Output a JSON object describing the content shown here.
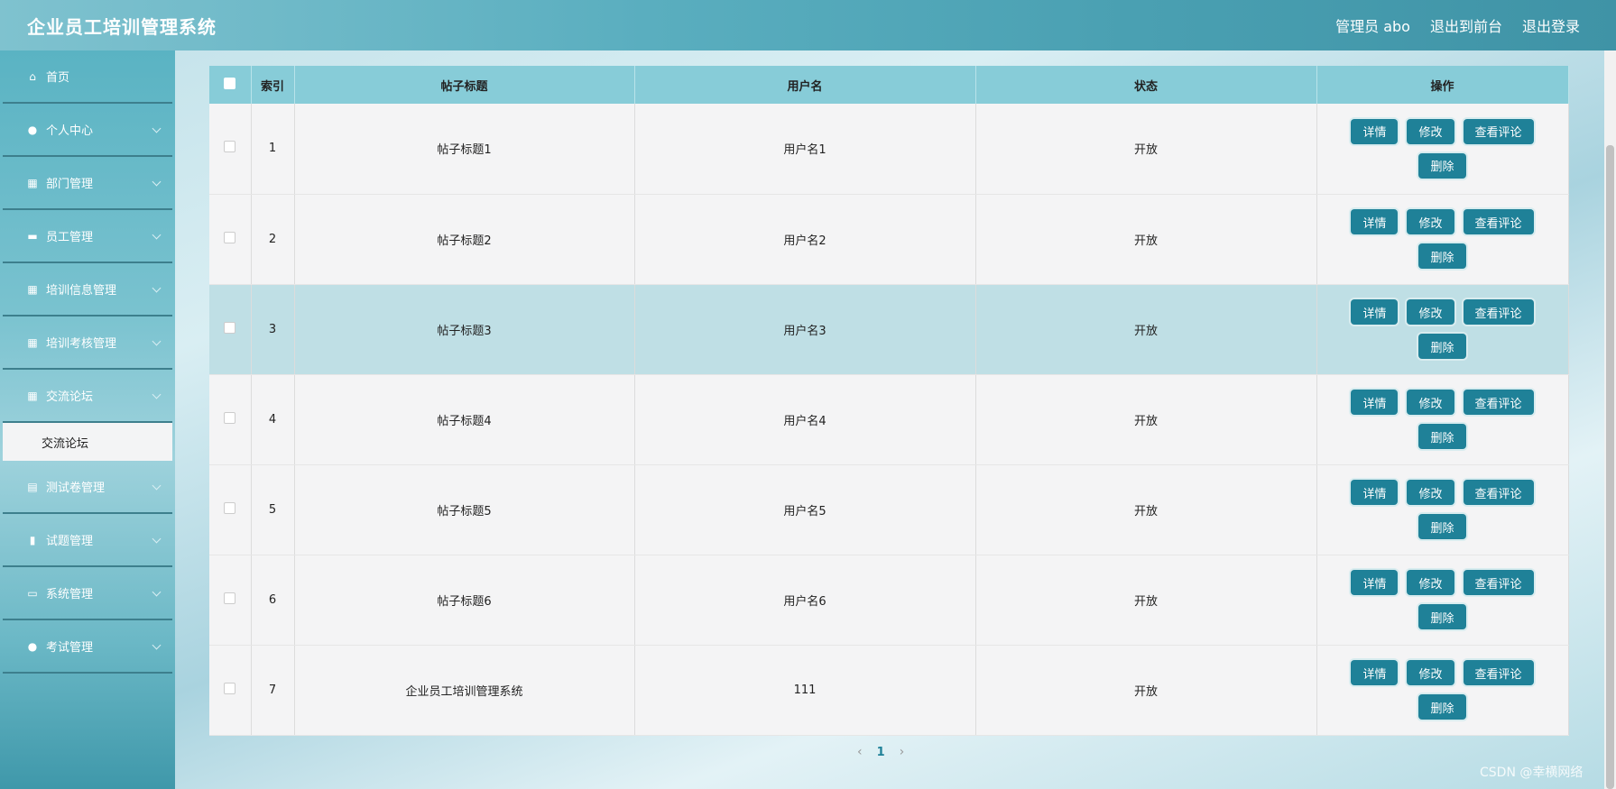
{
  "header": {
    "title": "企业员工培训管理系统",
    "user": "管理员 abo",
    "to_front": "退出到前台",
    "logout": "退出登录"
  },
  "sidebar": {
    "items": [
      {
        "label": "首页",
        "icon": "home-icon"
      },
      {
        "label": "个人中心",
        "icon": "user-icon"
      },
      {
        "label": "部门管理",
        "icon": "grid-icon"
      },
      {
        "label": "员工管理",
        "icon": "briefcase-icon"
      },
      {
        "label": "培训信息管理",
        "icon": "grid-icon"
      },
      {
        "label": "培训考核管理",
        "icon": "grid-icon"
      },
      {
        "label": "交流论坛",
        "icon": "grid-icon"
      },
      {
        "label": "交流论坛",
        "icon": ""
      },
      {
        "label": "测试卷管理",
        "icon": "clipboard-icon"
      },
      {
        "label": "试题管理",
        "icon": "bar-chart-icon"
      },
      {
        "label": "系统管理",
        "icon": "monitor-icon"
      },
      {
        "label": "考试管理",
        "icon": "pin-icon"
      }
    ]
  },
  "table": {
    "headers": [
      "索引",
      "帖子标题",
      "用户名",
      "状态",
      "操作"
    ],
    "rows": [
      {
        "index": "1",
        "title": "帖子标题1",
        "user": "用户名1",
        "status": "开放"
      },
      {
        "index": "2",
        "title": "帖子标题2",
        "user": "用户名2",
        "status": "开放"
      },
      {
        "index": "3",
        "title": "帖子标题3",
        "user": "用户名3",
        "status": "开放"
      },
      {
        "index": "4",
        "title": "帖子标题4",
        "user": "用户名4",
        "status": "开放"
      },
      {
        "index": "5",
        "title": "帖子标题5",
        "user": "用户名5",
        "status": "开放"
      },
      {
        "index": "6",
        "title": "帖子标题6",
        "user": "用户名6",
        "status": "开放"
      },
      {
        "index": "7",
        "title": "企业员工培训管理系统",
        "user": "111",
        "status": "开放"
      }
    ],
    "actions": {
      "detail": "详情",
      "edit": "修改",
      "comments": "查看评论",
      "delete": "删除"
    }
  },
  "pagination": {
    "prev": "‹",
    "page": "1",
    "next": "›"
  },
  "watermark": "CSDN @幸横网络",
  "colors": {
    "accent": "#1f8198",
    "header_bg": "#5aaebf",
    "table_header_bg": "#87ccd8",
    "highlight_row": "#bfdfe5"
  }
}
